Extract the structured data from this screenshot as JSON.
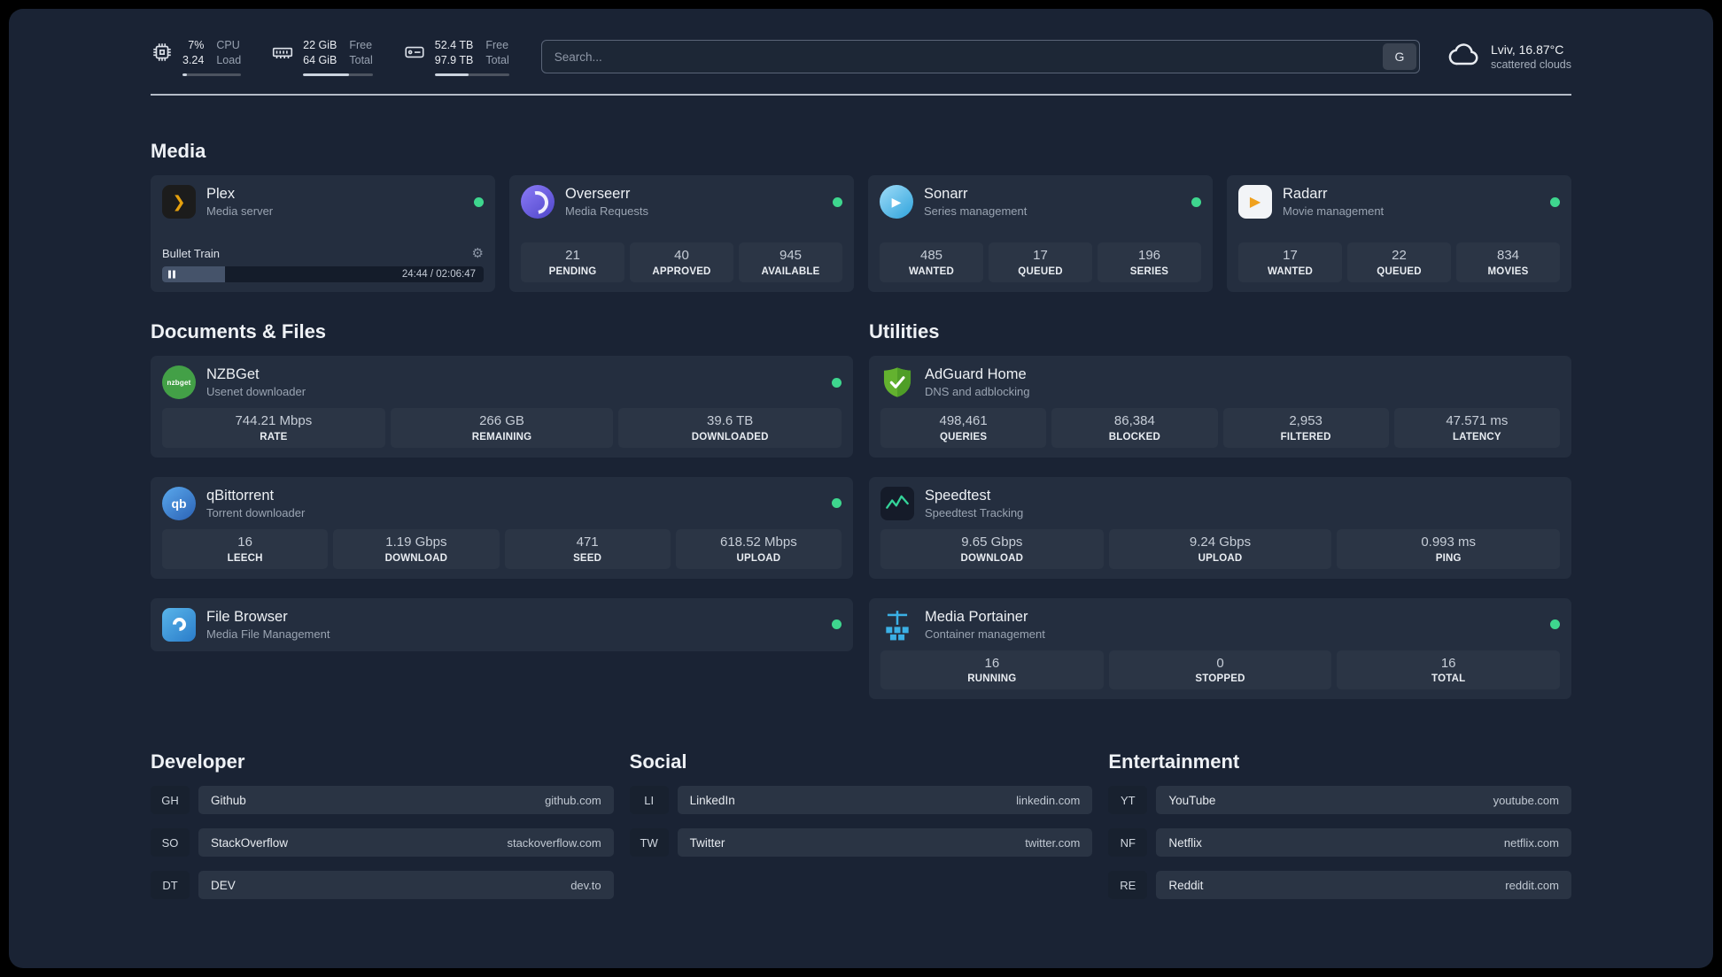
{
  "colors": {
    "background": "#1a2334",
    "card": "#242e3f",
    "status_online": "#3ed68e"
  },
  "topbar": {
    "resources": [
      {
        "icon": "cpu-icon",
        "values": [
          "7%",
          "3.24"
        ],
        "labels": [
          "CPU",
          "Load"
        ],
        "bar_percent": 7
      },
      {
        "icon": "ram-icon",
        "values": [
          "22 GiB",
          "64 GiB"
        ],
        "labels": [
          "Free",
          "Total"
        ],
        "bar_percent": 66
      },
      {
        "icon": "disk-icon",
        "values": [
          "52.4 TB",
          "97.9 TB"
        ],
        "labels": [
          "Free",
          "Total"
        ],
        "bar_percent": 46
      }
    ],
    "search": {
      "placeholder": "Search...",
      "button_label": "G"
    },
    "weather": {
      "location": "Lviv, 16.87°C",
      "condition": "scattered clouds"
    }
  },
  "sections": {
    "media": {
      "title": "Media",
      "cards": [
        {
          "name": "Plex",
          "subtitle": "Media server",
          "status": "online",
          "player": {
            "track": "Bullet Train",
            "time_display": "24:44 / 02:06:47",
            "progress_percent": 19.5
          }
        },
        {
          "name": "Overseerr",
          "subtitle": "Media Requests",
          "status": "online",
          "stats": [
            {
              "value": "21",
              "label": "PENDING"
            },
            {
              "value": "40",
              "label": "APPROVED"
            },
            {
              "value": "945",
              "label": "AVAILABLE"
            }
          ]
        },
        {
          "name": "Sonarr",
          "subtitle": "Series management",
          "status": "online",
          "stats": [
            {
              "value": "485",
              "label": "WANTED"
            },
            {
              "value": "17",
              "label": "QUEUED"
            },
            {
              "value": "196",
              "label": "SERIES"
            }
          ]
        },
        {
          "name": "Radarr",
          "subtitle": "Movie management",
          "status": "online",
          "stats": [
            {
              "value": "17",
              "label": "WANTED"
            },
            {
              "value": "22",
              "label": "QUEUED"
            },
            {
              "value": "834",
              "label": "MOVIES"
            }
          ]
        }
      ]
    },
    "documents": {
      "title": "Documents & Files",
      "cards": [
        {
          "name": "NZBGet",
          "subtitle": "Usenet downloader",
          "status": "online",
          "stats": [
            {
              "value": "744.21 Mbps",
              "label": "RATE"
            },
            {
              "value": "266 GB",
              "label": "REMAINING"
            },
            {
              "value": "39.6 TB",
              "label": "DOWNLOADED"
            }
          ]
        },
        {
          "name": "qBittorrent",
          "subtitle": "Torrent downloader",
          "status": "online",
          "stats": [
            {
              "value": "16",
              "label": "LEECH"
            },
            {
              "value": "1.19 Gbps",
              "label": "DOWNLOAD"
            },
            {
              "value": "471",
              "label": "SEED"
            },
            {
              "value": "618.52 Mbps",
              "label": "UPLOAD"
            }
          ]
        },
        {
          "name": "File Browser",
          "subtitle": "Media File Management",
          "status": "online"
        }
      ]
    },
    "utilities": {
      "title": "Utilities",
      "cards": [
        {
          "name": "AdGuard Home",
          "subtitle": "DNS and adblocking",
          "stats": [
            {
              "value": "498,461",
              "label": "QUERIES"
            },
            {
              "value": "86,384",
              "label": "BLOCKED"
            },
            {
              "value": "2,953",
              "label": "FILTERED"
            },
            {
              "value": "47.571 ms",
              "label": "LATENCY"
            }
          ]
        },
        {
          "name": "Speedtest",
          "subtitle": "Speedtest Tracking",
          "stats": [
            {
              "value": "9.65 Gbps",
              "label": "DOWNLOAD"
            },
            {
              "value": "9.24 Gbps",
              "label": "UPLOAD"
            },
            {
              "value": "0.993 ms",
              "label": "PING"
            }
          ]
        },
        {
          "name": "Media Portainer",
          "subtitle": "Container management",
          "status": "online",
          "stats": [
            {
              "value": "16",
              "label": "RUNNING"
            },
            {
              "value": "0",
              "label": "STOPPED"
            },
            {
              "value": "16",
              "label": "TOTAL"
            }
          ]
        }
      ]
    },
    "bookmarks": [
      {
        "title": "Developer",
        "items": [
          {
            "abbr": "GH",
            "name": "Github",
            "domain": "github.com"
          },
          {
            "abbr": "SO",
            "name": "StackOverflow",
            "domain": "stackoverflow.com"
          },
          {
            "abbr": "DT",
            "name": "DEV",
            "domain": "dev.to"
          }
        ]
      },
      {
        "title": "Social",
        "items": [
          {
            "abbr": "LI",
            "name": "LinkedIn",
            "domain": "linkedin.com"
          },
          {
            "abbr": "TW",
            "name": "Twitter",
            "domain": "twitter.com"
          }
        ]
      },
      {
        "title": "Entertainment",
        "items": [
          {
            "abbr": "YT",
            "name": "YouTube",
            "domain": "youtube.com"
          },
          {
            "abbr": "NF",
            "name": "Netflix",
            "domain": "netflix.com"
          },
          {
            "abbr": "RE",
            "name": "Reddit",
            "domain": "reddit.com"
          }
        ]
      }
    ]
  }
}
